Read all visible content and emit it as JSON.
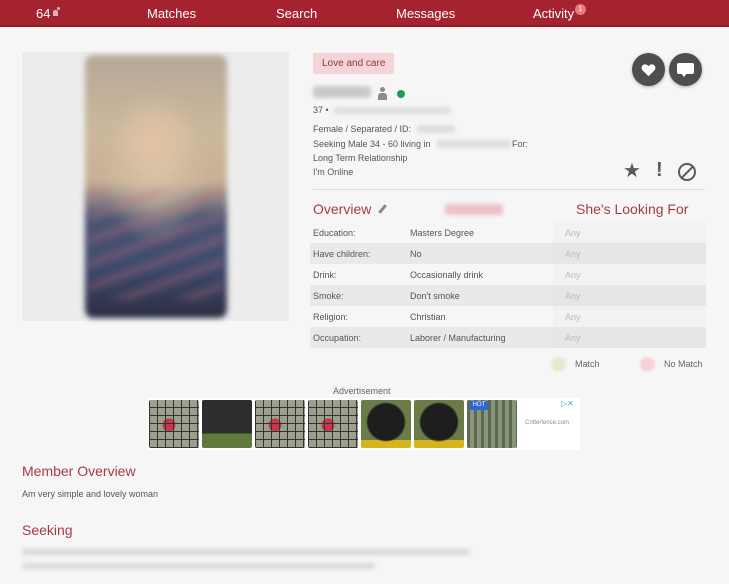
{
  "nav": {
    "count": "64",
    "items": [
      "Matches",
      "Search",
      "Messages",
      "Activity"
    ],
    "activity_badge": "1",
    "brand_color": "#a5232f"
  },
  "profile": {
    "tag": "Love and care",
    "age_prefix": "37 •",
    "status_dot_color": "#1f9a58",
    "details_line": "Female / Separated / ID:",
    "seeking_line": "Seeking Male 34 - 60 living in",
    "for_label": "For:",
    "relationship": "Long Term Relationship",
    "online_status": "I'm Online",
    "actions": [
      "heart-icon",
      "message-icon",
      "star-icon",
      "report-icon",
      "block-icon"
    ]
  },
  "overview": {
    "title": "Overview",
    "looking_for_title": "She's Looking For",
    "rows": [
      {
        "label": "Education:",
        "value": "Masters Degree",
        "wants": "Any"
      },
      {
        "label": "Have children:",
        "value": "No",
        "wants": "Any"
      },
      {
        "label": "Drink:",
        "value": "Occasionally drink",
        "wants": "Any"
      },
      {
        "label": "Smoke:",
        "value": "Don't smoke",
        "wants": "Any"
      },
      {
        "label": "Religion:",
        "value": "Christian",
        "wants": "Any"
      },
      {
        "label": "Occupation:",
        "value": "Laborer / Manufacturing",
        "wants": "Any"
      }
    ],
    "legend": {
      "match": "Match",
      "no_match": "No Match",
      "match_color": "#e3ebcf",
      "no_match_color": "#f6d3d8"
    }
  },
  "ad": {
    "label": "Advertisement",
    "hot_badge": "HOT",
    "brand": "Critterfence.com"
  },
  "member_overview": {
    "title": "Member Overview",
    "text": "Am very simple and lovely woman"
  },
  "seeking": {
    "title": "Seeking"
  }
}
